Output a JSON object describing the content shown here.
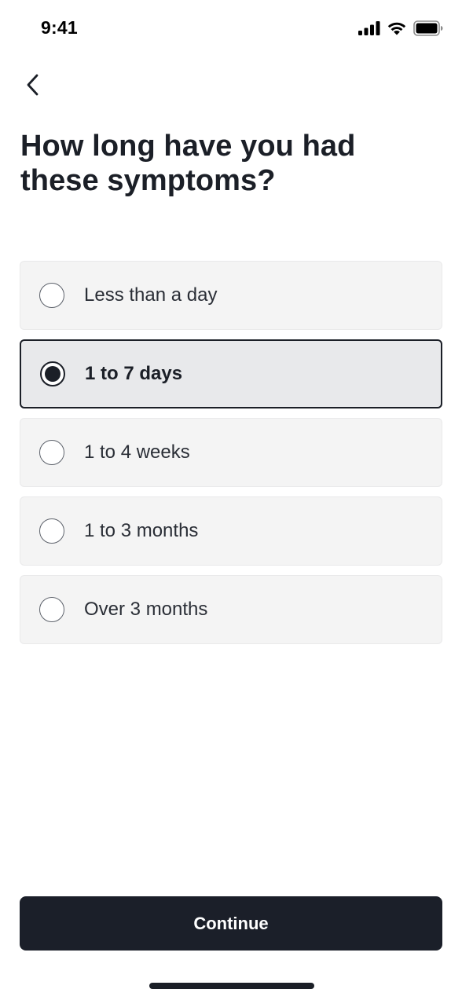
{
  "status_bar": {
    "time": "9:41",
    "icons": [
      "cellular-signal-icon",
      "wifi-icon",
      "battery-icon"
    ]
  },
  "header": {
    "back_icon": "chevron-left-icon"
  },
  "question": {
    "title": "How long have you had these symptoms?"
  },
  "options": [
    {
      "label": "Less than a day",
      "selected": false
    },
    {
      "label": "1 to 7 days",
      "selected": true
    },
    {
      "label": "1 to 4 weeks",
      "selected": false
    },
    {
      "label": "1 to 3 months",
      "selected": false
    },
    {
      "label": "Over 3 months",
      "selected": false
    }
  ],
  "footer": {
    "continue_label": "Continue"
  },
  "colors": {
    "primary": "#1b1f29",
    "option_background": "#f4f4f4",
    "option_selected_background": "#e8e9eb"
  }
}
